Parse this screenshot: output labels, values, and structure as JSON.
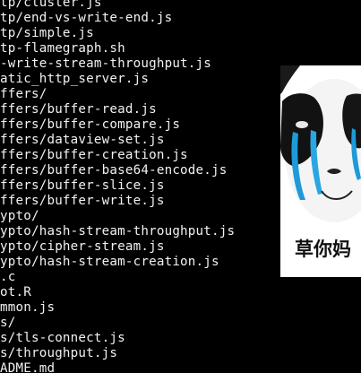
{
  "terminal": {
    "lines": [
      "tp/cluster.js",
      "tp/end-vs-write-end.js",
      "tp/simple.js",
      "tp-flamegraph.sh",
      "-write-stream-throughput.js",
      "atic_http_server.js",
      "ffers/",
      "ffers/buffer-read.js",
      "ffers/buffer-compare.js",
      "ffers/dataview-set.js",
      "ffers/buffer-creation.js",
      "ffers/buffer-base64-encode.js",
      "ffers/buffer-slice.js",
      "ffers/buffer-write.js",
      "ypto/",
      "ypto/hash-stream-throughput.js",
      "ypto/cipher-stream.js",
      "ypto/hash-stream-creation.js",
      ".c",
      "ot.R",
      "mmon.js",
      "s/",
      "s/tls-connect.js",
      "s/throughput.js",
      "ADME.md"
    ]
  },
  "meme": {
    "caption": "草你妈"
  },
  "colors": {
    "background": "#000000",
    "text": "#f2f2f2",
    "tears": "#1e9ad8"
  }
}
